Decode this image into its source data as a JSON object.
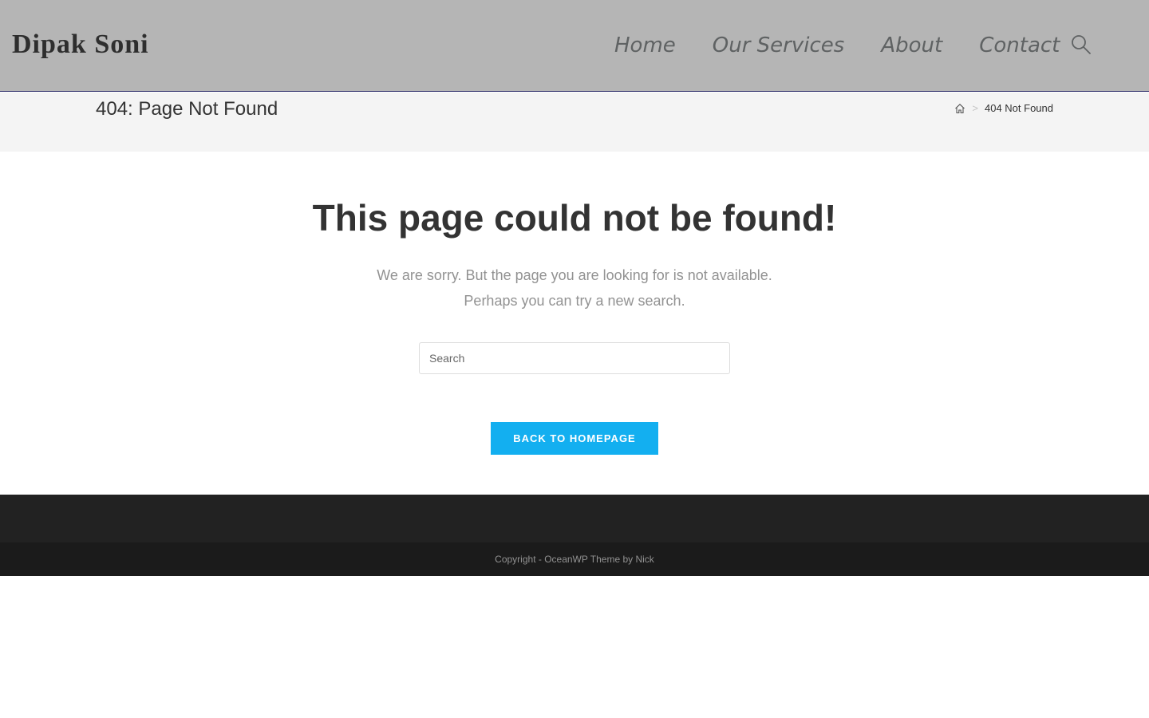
{
  "site": {
    "title": "Dipak Soni"
  },
  "nav": {
    "items": [
      {
        "label": "Home"
      },
      {
        "label": "Our Services"
      },
      {
        "label": "About"
      },
      {
        "label": "Contact"
      }
    ],
    "search_icon": "search-icon"
  },
  "page_header": {
    "title": "404: Page Not Found",
    "breadcrumb": {
      "home_icon": "home-icon",
      "separator": ">",
      "current": "404 Not Found"
    }
  },
  "content": {
    "heading": "This page could not be found!",
    "message_line1": "We are sorry. But the page you are looking for is not available.",
    "message_line2": "Perhaps you can try a new search.",
    "search": {
      "placeholder": "Search",
      "value": ""
    },
    "back_button": "Back To Homepage"
  },
  "footer": {
    "copyright": "Copyright - OceanWP Theme by Nick"
  },
  "colors": {
    "header_bg": "#b5b5b5",
    "accent": "#13aff0",
    "footer_bg": "#222222",
    "footer_bottom_bg": "#1b1b1b"
  }
}
